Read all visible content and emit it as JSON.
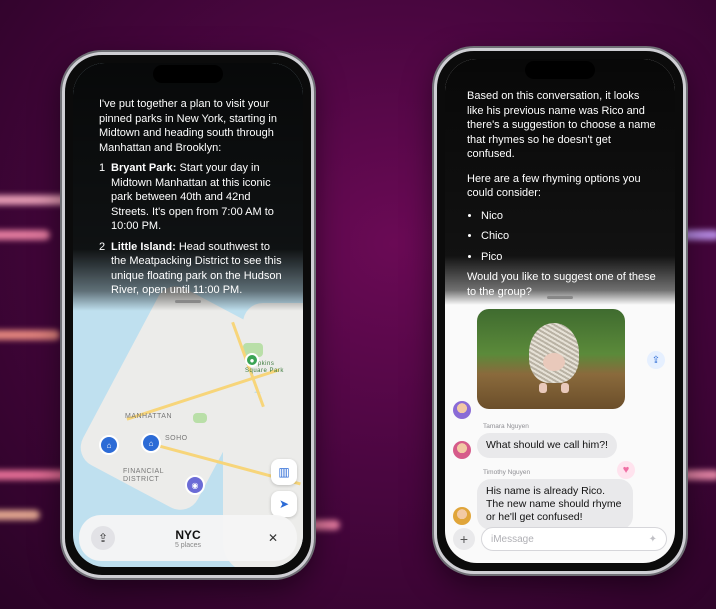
{
  "left_phone": {
    "assistant_intro": "I've put together a plan to visit your pinned parks in New York, starting in Midtown and heading south through Manhattan and Brooklyn:",
    "items": [
      {
        "num": "1",
        "name": "Bryant Park:",
        "text": " Start your day in Midtown Manhattan at this iconic park between 40th and 42nd Streets. It's open from 7:00 AM to 10:00 PM."
      },
      {
        "num": "2",
        "name": "Little Island:",
        "text": " Head southwest to the Meatpacking District to see this unique floating park on the Hudson River, open until 11:00 PM."
      }
    ],
    "map_labels": {
      "manhattan": "MANHATTAN",
      "tompkins": "Tompkins Square Park",
      "soho": "SOHO",
      "financial": "FINANCIAL DISTRICT"
    },
    "card": {
      "title": "NYC",
      "subtitle": "5 places",
      "close": "✕",
      "share": "⇪"
    }
  },
  "right_phone": {
    "assistant_text_1": "Based on this conversation, it looks like his previous name was Rico and there's a suggestion to choose a name that rhymes so he doesn't get confused.",
    "assistant_text_2": "Here are a few rhyming options you could consider:",
    "options": [
      "Nico",
      "Chico",
      "Pico"
    ],
    "assistant_question": "Would you like to suggest one of these to the group?",
    "messages": [
      {
        "sender": "Tamara Nguyen",
        "text": "What should we call him?!"
      },
      {
        "sender": "Timothy Nguyen",
        "text": "His name is already Rico. The new name should rhyme or he'll get confused!"
      }
    ],
    "compose_placeholder": "iMessage",
    "plus": "+",
    "reaction": "♥"
  },
  "colors": {
    "accent_pin": "#2c6bd6",
    "reaction": "#f06fa4"
  }
}
